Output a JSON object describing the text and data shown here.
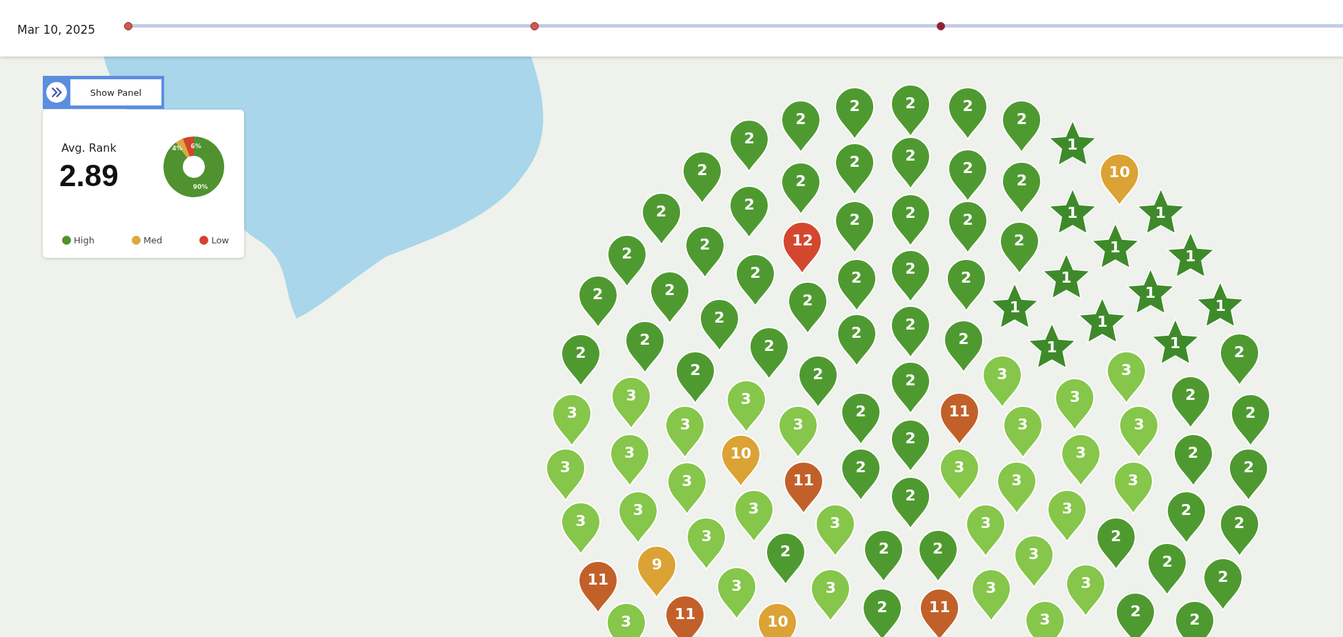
{
  "timeline": {
    "date": "Mar 10, 2025",
    "stops": [
      {
        "selected": false
      },
      {
        "selected": false
      },
      {
        "selected": true
      }
    ]
  },
  "panel_toggle": {
    "label": "Show Panel"
  },
  "summary_card": {
    "title": "Avg. Rank",
    "value": "2.89",
    "chart_data": {
      "type": "donut",
      "categories": [
        "High",
        "Med",
        "Low"
      ],
      "values": [
        90,
        4,
        6
      ],
      "colors": [
        "#4f922f",
        "#d9aa3a",
        "#d4432e"
      ],
      "value_labels": [
        "90%",
        "4%",
        "6%"
      ]
    }
  },
  "pins": [
    {
      "label": "2",
      "kind": "pin",
      "color": "#4f9a30"
    },
    {
      "label": "2",
      "kind": "pin",
      "color": "#4f9a30"
    },
    {
      "label": "2",
      "kind": "pin",
      "color": "#4f9a30"
    },
    {
      "label": "2",
      "kind": "pin",
      "color": "#4f9a30"
    },
    {
      "label": "2",
      "kind": "pin",
      "color": "#4f9a30"
    },
    {
      "label": "1",
      "kind": "star",
      "color": "#3e8a2a"
    },
    {
      "label": "10",
      "kind": "pin",
      "color": "#dba235"
    },
    {
      "label": "2",
      "kind": "pin",
      "color": "#4f9a30"
    },
    {
      "label": "2",
      "kind": "pin",
      "color": "#4f9a30"
    },
    {
      "label": "2",
      "kind": "pin",
      "color": "#4f9a30"
    },
    {
      "label": "2",
      "kind": "pin",
      "color": "#4f9a30"
    },
    {
      "label": "2",
      "kind": "pin",
      "color": "#4f9a30"
    },
    {
      "label": "1",
      "kind": "star",
      "color": "#3e8a2a"
    },
    {
      "label": "1",
      "kind": "star",
      "color": "#3e8a2a"
    },
    {
      "label": "2",
      "kind": "pin",
      "color": "#4f9a30"
    },
    {
      "label": "2",
      "kind": "pin",
      "color": "#4f9a30"
    },
    {
      "label": "2",
      "kind": "pin",
      "color": "#4f9a30"
    },
    {
      "label": "2",
      "kind": "pin",
      "color": "#4f9a30"
    },
    {
      "label": "2",
      "kind": "pin",
      "color": "#4f9a30"
    },
    {
      "label": "2",
      "kind": "pin",
      "color": "#4f9a30"
    },
    {
      "label": "2",
      "kind": "pin",
      "color": "#4f9a30"
    },
    {
      "label": "2",
      "kind": "pin",
      "color": "#4f9a30"
    },
    {
      "label": "1",
      "kind": "star",
      "color": "#3e8a2a"
    },
    {
      "label": "1",
      "kind": "star",
      "color": "#3e8a2a"
    },
    {
      "label": "1",
      "kind": "star",
      "color": "#3e8a2a"
    },
    {
      "label": "2",
      "kind": "pin",
      "color": "#4f9a30"
    },
    {
      "label": "2",
      "kind": "pin",
      "color": "#4f9a30"
    },
    {
      "label": "12",
      "kind": "pin",
      "color": "#d4472f"
    },
    {
      "label": "2",
      "kind": "pin",
      "color": "#4f9a30"
    },
    {
      "label": "2",
      "kind": "pin",
      "color": "#4f9a30"
    },
    {
      "label": "2",
      "kind": "pin",
      "color": "#4f9a30"
    },
    {
      "label": "2",
      "kind": "pin",
      "color": "#4f9a30"
    },
    {
      "label": "1",
      "kind": "star",
      "color": "#3e8a2a"
    },
    {
      "label": "1",
      "kind": "star",
      "color": "#3e8a2a"
    },
    {
      "label": "1",
      "kind": "star",
      "color": "#3e8a2a"
    },
    {
      "label": "2",
      "kind": "pin",
      "color": "#4f9a30"
    },
    {
      "label": "2",
      "kind": "pin",
      "color": "#4f9a30"
    },
    {
      "label": "2",
      "kind": "pin",
      "color": "#4f9a30"
    },
    {
      "label": "2",
      "kind": "pin",
      "color": "#4f9a30"
    },
    {
      "label": "2",
      "kind": "pin",
      "color": "#4f9a30"
    },
    {
      "label": "2",
      "kind": "pin",
      "color": "#4f9a30"
    },
    {
      "label": "2",
      "kind": "pin",
      "color": "#4f9a30"
    },
    {
      "label": "1",
      "kind": "star",
      "color": "#3e8a2a"
    },
    {
      "label": "1",
      "kind": "star",
      "color": "#3e8a2a"
    },
    {
      "label": "1",
      "kind": "star",
      "color": "#3e8a2a"
    },
    {
      "label": "2",
      "kind": "pin",
      "color": "#4f9a30"
    },
    {
      "label": "2",
      "kind": "pin",
      "color": "#4f9a30"
    },
    {
      "label": "2",
      "kind": "pin",
      "color": "#4f9a30"
    },
    {
      "label": "2",
      "kind": "pin",
      "color": "#4f9a30"
    },
    {
      "label": "2",
      "kind": "pin",
      "color": "#4f9a30"
    },
    {
      "label": "2",
      "kind": "pin",
      "color": "#4f9a30"
    },
    {
      "label": "3",
      "kind": "pin",
      "color": "#86c64a"
    },
    {
      "label": "3",
      "kind": "pin",
      "color": "#86c64a"
    },
    {
      "label": "2",
      "kind": "pin",
      "color": "#4f9a30"
    },
    {
      "label": "3",
      "kind": "pin",
      "color": "#86c64a"
    },
    {
      "label": "3",
      "kind": "pin",
      "color": "#86c64a"
    },
    {
      "label": "3",
      "kind": "pin",
      "color": "#86c64a"
    },
    {
      "label": "11",
      "kind": "pin",
      "color": "#c2602a"
    },
    {
      "label": "3",
      "kind": "pin",
      "color": "#86c64a"
    },
    {
      "label": "2",
      "kind": "pin",
      "color": "#4f9a30"
    },
    {
      "label": "2",
      "kind": "pin",
      "color": "#4f9a30"
    },
    {
      "label": "3",
      "kind": "pin",
      "color": "#86c64a"
    },
    {
      "label": "3",
      "kind": "pin",
      "color": "#86c64a"
    },
    {
      "label": "2",
      "kind": "pin",
      "color": "#4f9a30"
    },
    {
      "label": "3",
      "kind": "pin",
      "color": "#86c64a"
    },
    {
      "label": "3",
      "kind": "pin",
      "color": "#86c64a"
    },
    {
      "label": "3",
      "kind": "pin",
      "color": "#86c64a"
    },
    {
      "label": "3",
      "kind": "pin",
      "color": "#86c64a"
    },
    {
      "label": "10",
      "kind": "pin",
      "color": "#dba235"
    },
    {
      "label": "2",
      "kind": "pin",
      "color": "#4f9a30"
    },
    {
      "label": "3",
      "kind": "pin",
      "color": "#86c64a"
    },
    {
      "label": "2",
      "kind": "pin",
      "color": "#4f9a30"
    },
    {
      "label": "3",
      "kind": "pin",
      "color": "#86c64a"
    },
    {
      "label": "2",
      "kind": "pin",
      "color": "#4f9a30"
    },
    {
      "label": "3",
      "kind": "pin",
      "color": "#86c64a"
    },
    {
      "label": "3",
      "kind": "pin",
      "color": "#86c64a"
    },
    {
      "label": "3",
      "kind": "pin",
      "color": "#86c64a"
    },
    {
      "label": "2",
      "kind": "pin",
      "color": "#4f9a30"
    },
    {
      "label": "11",
      "kind": "pin",
      "color": "#c2602a"
    },
    {
      "label": "3",
      "kind": "pin",
      "color": "#86c64a"
    },
    {
      "label": "3",
      "kind": "pin",
      "color": "#86c64a"
    },
    {
      "label": "3",
      "kind": "pin",
      "color": "#86c64a"
    },
    {
      "label": "2",
      "kind": "pin",
      "color": "#4f9a30"
    },
    {
      "label": "3",
      "kind": "pin",
      "color": "#86c64a"
    },
    {
      "label": "2",
      "kind": "pin",
      "color": "#4f9a30"
    },
    {
      "label": "2",
      "kind": "pin",
      "color": "#4f9a30"
    },
    {
      "label": "3",
      "kind": "pin",
      "color": "#86c64a"
    },
    {
      "label": "3",
      "kind": "pin",
      "color": "#86c64a"
    },
    {
      "label": "3",
      "kind": "pin",
      "color": "#86c64a"
    },
    {
      "label": "2",
      "kind": "pin",
      "color": "#4f9a30"
    },
    {
      "label": "2",
      "kind": "pin",
      "color": "#4f9a30"
    },
    {
      "label": "2",
      "kind": "pin",
      "color": "#4f9a30"
    },
    {
      "label": "2",
      "kind": "pin",
      "color": "#4f9a30"
    },
    {
      "label": "3",
      "kind": "pin",
      "color": "#86c64a"
    },
    {
      "label": "2",
      "kind": "pin",
      "color": "#4f9a30"
    },
    {
      "label": "2",
      "kind": "pin",
      "color": "#4f9a30"
    },
    {
      "label": "9",
      "kind": "pin",
      "color": "#dba235"
    },
    {
      "label": "11",
      "kind": "pin",
      "color": "#c2602a"
    },
    {
      "label": "3",
      "kind": "pin",
      "color": "#86c64a"
    },
    {
      "label": "3",
      "kind": "pin",
      "color": "#86c64a"
    },
    {
      "label": "3",
      "kind": "pin",
      "color": "#86c64a"
    },
    {
      "label": "3",
      "kind": "pin",
      "color": "#86c64a"
    },
    {
      "label": "11",
      "kind": "pin",
      "color": "#c2602a"
    },
    {
      "label": "10",
      "kind": "pin",
      "color": "#dba235"
    },
    {
      "label": "2",
      "kind": "pin",
      "color": "#4f9a30"
    },
    {
      "label": "11",
      "kind": "pin",
      "color": "#c2602a"
    },
    {
      "label": "3",
      "kind": "pin",
      "color": "#86c64a"
    },
    {
      "label": "3",
      "kind": "pin",
      "color": "#86c64a"
    },
    {
      "label": "2",
      "kind": "pin",
      "color": "#4f9a30"
    },
    {
      "label": "2",
      "kind": "pin",
      "color": "#4f9a30"
    }
  ]
}
